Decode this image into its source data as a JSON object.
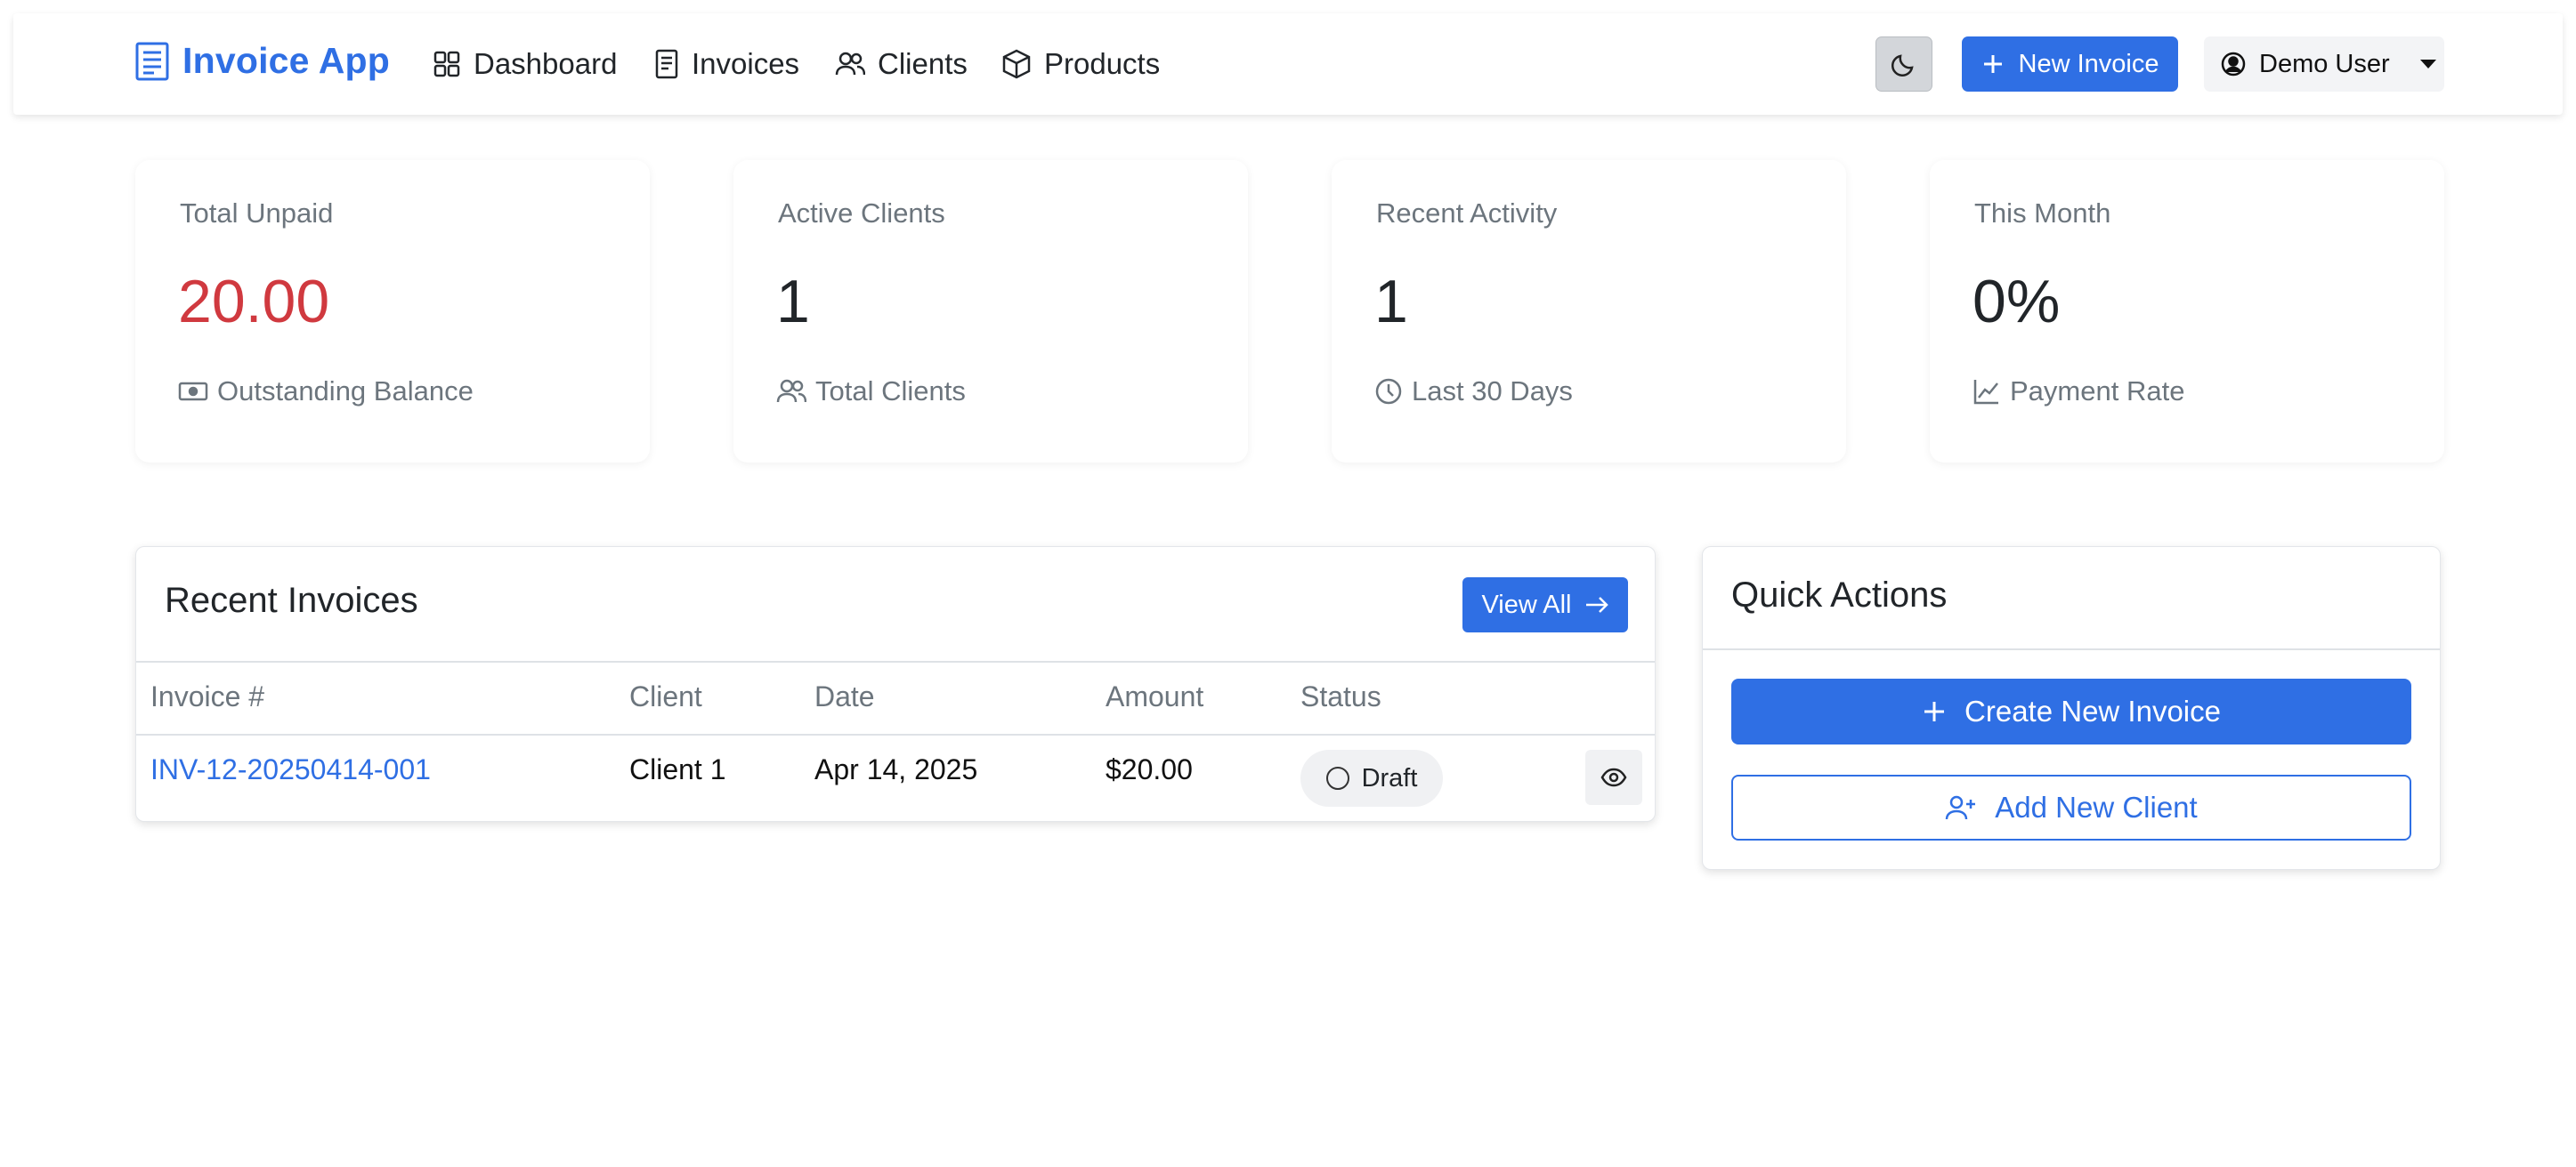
{
  "navbar": {
    "brand": "Invoice App",
    "links": [
      {
        "label": "Dashboard",
        "icon": "dashboard-grid-icon"
      },
      {
        "label": "Invoices",
        "icon": "document-icon"
      },
      {
        "label": "Clients",
        "icon": "people-icon"
      },
      {
        "label": "Products",
        "icon": "box-icon"
      }
    ],
    "theme_toggle_icon": "moon-icon",
    "new_invoice_label": "New Invoice",
    "user_label": "Demo User"
  },
  "stats": [
    {
      "label": "Total Unpaid",
      "value": "20.00",
      "sub": "Outstanding Balance",
      "icon": "cash-icon",
      "value_color": "#d0393f"
    },
    {
      "label": "Active Clients",
      "value": "1",
      "sub": "Total Clients",
      "icon": "people-icon"
    },
    {
      "label": "Recent Activity",
      "value": "1",
      "sub": "Last 30 Days",
      "icon": "clock-icon"
    },
    {
      "label": "This Month",
      "value": "0%",
      "sub": "Payment Rate",
      "icon": "line-chart-icon"
    }
  ],
  "recent_invoices": {
    "title": "Recent Invoices",
    "view_all_label": "View All",
    "columns": [
      "Invoice #",
      "Client",
      "Date",
      "Amount",
      "Status"
    ],
    "rows": [
      {
        "invoice": "INV-12-20250414-001",
        "client": "Client 1",
        "date": "Apr 14, 2025",
        "amount": "$20.00",
        "status": "Draft"
      }
    ]
  },
  "quick_actions": {
    "title": "Quick Actions",
    "create_label": "Create New Invoice",
    "add_client_label": "Add New Client"
  },
  "colors": {
    "primary": "#2f6fe4",
    "danger": "#d0393f",
    "muted": "#6c757d"
  }
}
